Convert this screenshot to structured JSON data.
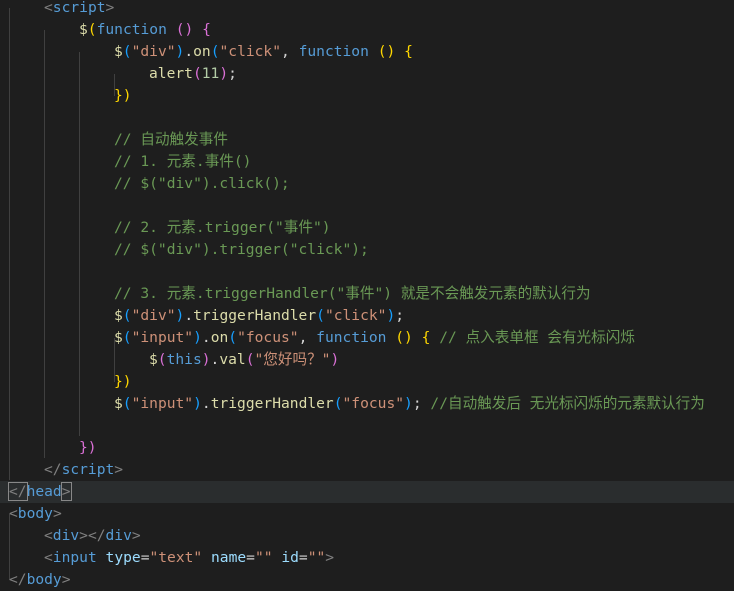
{
  "editor": {
    "lines": [
      [
        [
          "tag-bracket",
          "<"
        ],
        [
          "tag",
          "script"
        ],
        [
          "tag-bracket",
          ">"
        ]
      ],
      [
        [
          "fn",
          "$"
        ],
        [
          "p1",
          "("
        ],
        [
          "kw",
          "function"
        ],
        [
          "txt",
          " "
        ],
        [
          "p2",
          "()"
        ],
        [
          "txt",
          " "
        ],
        [
          "p2",
          "{"
        ]
      ],
      [
        [
          "fn",
          "$"
        ],
        [
          "p3",
          "("
        ],
        [
          "str",
          "\"div\""
        ],
        [
          "p3",
          ")"
        ],
        [
          "txt",
          "."
        ],
        [
          "fn",
          "on"
        ],
        [
          "p3",
          "("
        ],
        [
          "str",
          "\"click\""
        ],
        [
          "txt",
          ", "
        ],
        [
          "kw",
          "function"
        ],
        [
          "txt",
          " "
        ],
        [
          "p1",
          "()"
        ],
        [
          "txt",
          " "
        ],
        [
          "p1",
          "{"
        ]
      ],
      [
        [
          "fn",
          "alert"
        ],
        [
          "p2",
          "("
        ],
        [
          "num",
          "11"
        ],
        [
          "p2",
          ")"
        ],
        [
          "txt",
          ";"
        ]
      ],
      [
        [
          "p1",
          "})"
        ]
      ],
      [
        [
          "txt",
          ""
        ]
      ],
      [
        [
          "cmt",
          "// 自动触发事件"
        ]
      ],
      [
        [
          "cmt",
          "// 1. 元素.事件()"
        ]
      ],
      [
        [
          "cmt",
          "// $(\"div\").click();"
        ]
      ],
      [
        [
          "txt",
          ""
        ]
      ],
      [
        [
          "cmt",
          "// 2. 元素.trigger(\"事件\")"
        ]
      ],
      [
        [
          "cmt",
          "// $(\"div\").trigger(\"click\");"
        ]
      ],
      [
        [
          "txt",
          ""
        ]
      ],
      [
        [
          "cmt",
          "// 3. 元素.triggerHandler(\"事件\") 就是不会触发元素的默认行为"
        ]
      ],
      [
        [
          "fn",
          "$"
        ],
        [
          "p3",
          "("
        ],
        [
          "str",
          "\"div\""
        ],
        [
          "p3",
          ")"
        ],
        [
          "txt",
          "."
        ],
        [
          "fn",
          "triggerHandler"
        ],
        [
          "p3",
          "("
        ],
        [
          "str",
          "\"click\""
        ],
        [
          "p3",
          ")"
        ],
        [
          "txt",
          ";"
        ]
      ],
      [
        [
          "fn",
          "$"
        ],
        [
          "p3",
          "("
        ],
        [
          "str",
          "\"input\""
        ],
        [
          "p3",
          ")"
        ],
        [
          "txt",
          "."
        ],
        [
          "fn",
          "on"
        ],
        [
          "p3",
          "("
        ],
        [
          "str",
          "\"focus\""
        ],
        [
          "txt",
          ", "
        ],
        [
          "kw",
          "function"
        ],
        [
          "txt",
          " "
        ],
        [
          "p1",
          "()"
        ],
        [
          "txt",
          " "
        ],
        [
          "p1",
          "{"
        ],
        [
          "txt",
          " "
        ],
        [
          "cmt",
          "// 点入表单框 会有光标闪烁"
        ]
      ],
      [
        [
          "fn",
          "$"
        ],
        [
          "p2",
          "("
        ],
        [
          "kw",
          "this"
        ],
        [
          "p2",
          ")"
        ],
        [
          "txt",
          "."
        ],
        [
          "fn",
          "val"
        ],
        [
          "p2",
          "("
        ],
        [
          "str",
          "\"您好吗？\""
        ],
        [
          "p2",
          ")"
        ]
      ],
      [
        [
          "p1",
          "})"
        ]
      ],
      [
        [
          "fn",
          "$"
        ],
        [
          "p3",
          "("
        ],
        [
          "str",
          "\"input\""
        ],
        [
          "p3",
          ")"
        ],
        [
          "txt",
          "."
        ],
        [
          "fn",
          "triggerHandler"
        ],
        [
          "p3",
          "("
        ],
        [
          "str",
          "\"focus\""
        ],
        [
          "p3",
          ")"
        ],
        [
          "txt",
          "; "
        ],
        [
          "cmt",
          "//自动触发后 无光标闪烁的元素默认行为"
        ]
      ],
      [
        [
          "txt",
          ""
        ]
      ],
      [
        [
          "p2",
          "})"
        ]
      ],
      [
        [
          "tag-bracket",
          "</"
        ],
        [
          "tag",
          "script"
        ],
        [
          "tag-bracket",
          ">"
        ]
      ],
      [
        [
          "tag-bracket",
          "</"
        ],
        [
          "tag",
          "head"
        ],
        [
          "tag-bracket",
          ">"
        ]
      ],
      [
        [
          "tag-bracket",
          "<"
        ],
        [
          "tag",
          "body"
        ],
        [
          "tag-bracket",
          ">"
        ]
      ],
      [
        [
          "tag-bracket",
          "<"
        ],
        [
          "tag",
          "div"
        ],
        [
          "tag-bracket",
          "></"
        ],
        [
          "tag",
          "div"
        ],
        [
          "tag-bracket",
          ">"
        ]
      ],
      [
        [
          "tag-bracket",
          "<"
        ],
        [
          "tag",
          "input"
        ],
        [
          "txt",
          " "
        ],
        [
          "attr",
          "type"
        ],
        [
          "txt",
          "="
        ],
        [
          "str",
          "\"text\""
        ],
        [
          "txt",
          " "
        ],
        [
          "attr",
          "name"
        ],
        [
          "txt",
          "="
        ],
        [
          "str",
          "\"\""
        ],
        [
          "txt",
          " "
        ],
        [
          "attr",
          "id"
        ],
        [
          "txt",
          "="
        ],
        [
          "str",
          "\"\""
        ],
        [
          "tag-bracket",
          ">"
        ]
      ],
      [
        [
          "tag-bracket",
          "</"
        ],
        [
          "tag",
          "body"
        ],
        [
          "tag-bracket",
          ">"
        ]
      ]
    ]
  }
}
